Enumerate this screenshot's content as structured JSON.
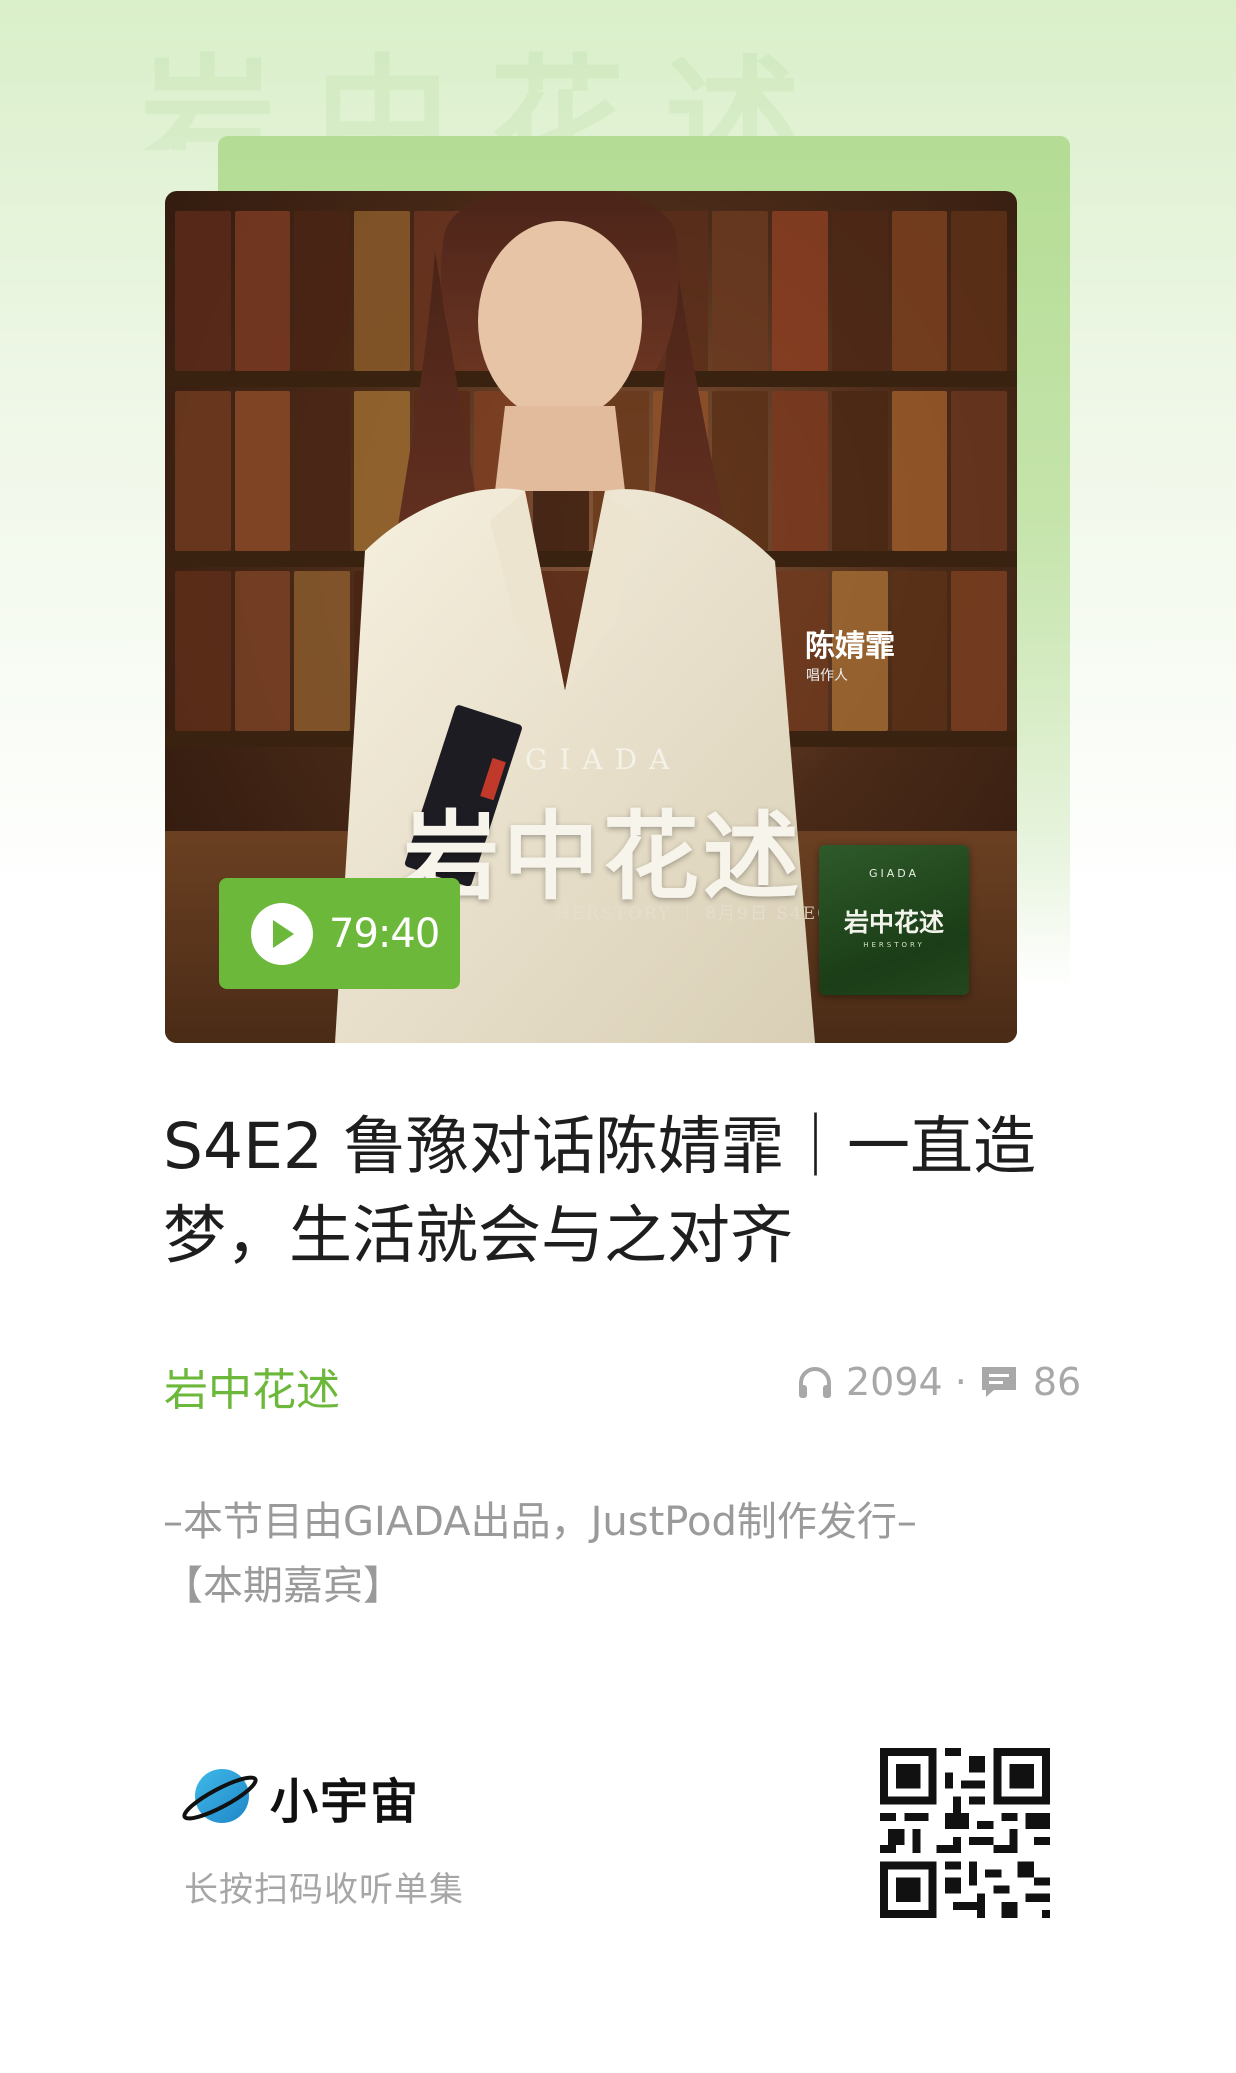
{
  "background_watermark": "岩中花述",
  "cover": {
    "guest_name": "陈婧霏",
    "guest_role": "唱作人",
    "brand": "GIADA",
    "show_title": "岩中花述",
    "meta": "HERSTORY ｜ 8月9日 S4E02",
    "thumbnail": {
      "brand": "GIADA",
      "title": "岩中花述",
      "subtitle": "HERSTORY"
    }
  },
  "player": {
    "duration": "79:40",
    "icon": "play-icon"
  },
  "episode": {
    "title": "S4E2 鲁豫对话陈婧霏｜一直造梦，生活就会与之对齐",
    "podcast": "岩中花述",
    "listens": "2094",
    "separator": "·",
    "comments": "86",
    "description_lines": [
      "–本节目由GIADA出品，JustPod制作发行–",
      "【本期嘉宾】"
    ]
  },
  "footer": {
    "app_name": "小宇宙",
    "scan_hint": "长按扫码收听单集"
  },
  "colors": {
    "accent": "#6cb83a",
    "title": "#1e1e1e",
    "muted": "#a8a8a8"
  }
}
